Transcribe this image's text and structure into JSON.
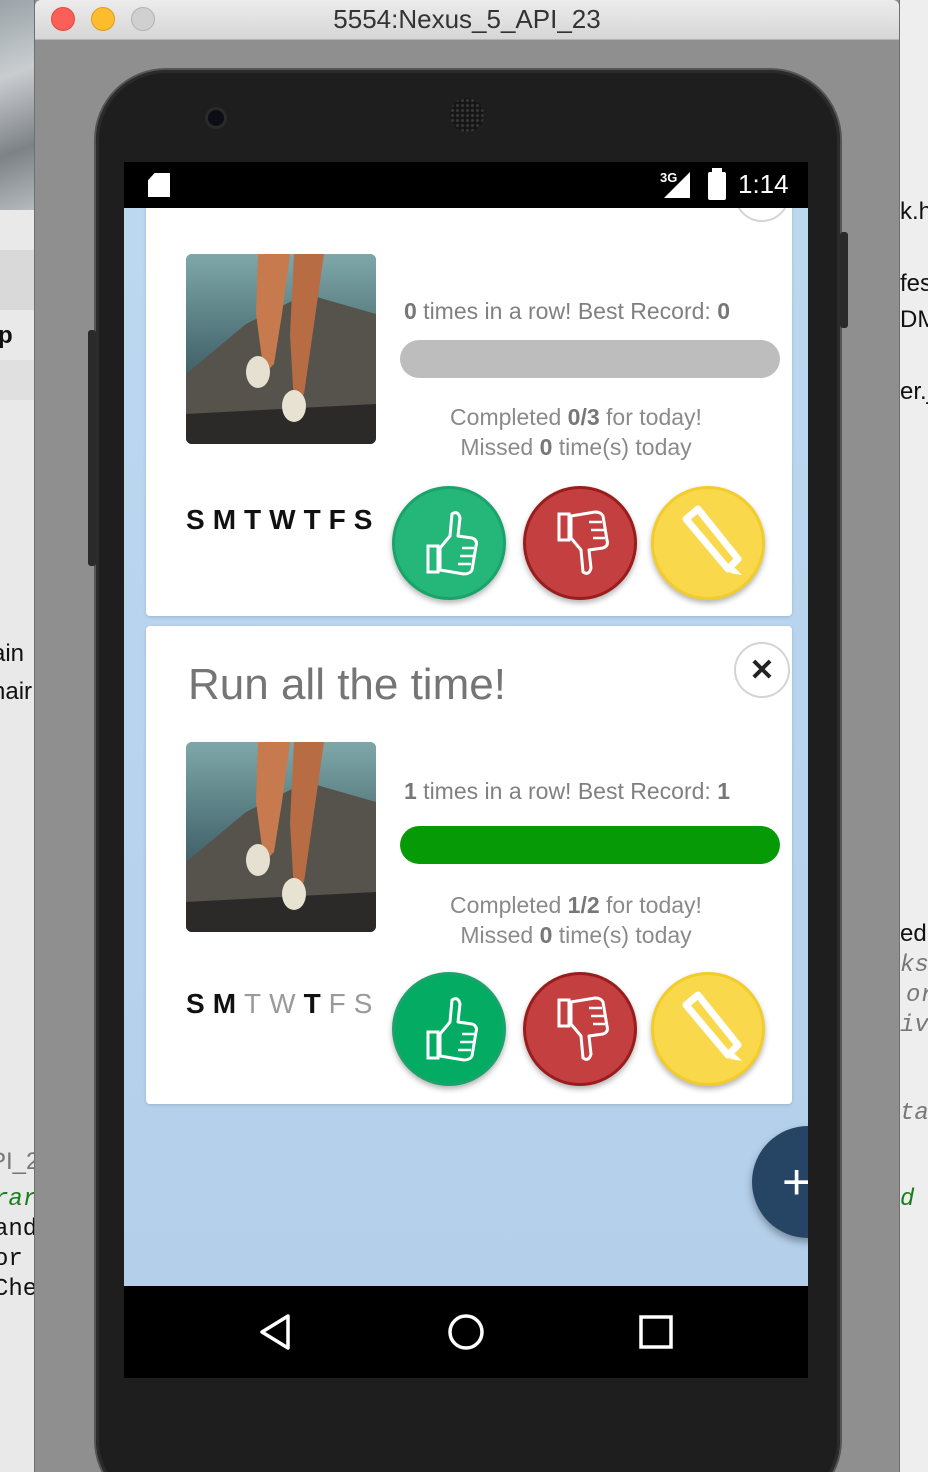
{
  "window": {
    "title": "5554:Nexus_5_API_23"
  },
  "background_text": {
    "left": [
      "p",
      "ain",
      "nair",
      "PI_2",
      "rar",
      "and",
      "or v",
      "Che"
    ],
    "right": [
      "k.ht",
      "fes",
      "DM",
      "er.j",
      "ed",
      "ks",
      "or",
      "ivi",
      "ta",
      "d"
    ]
  },
  "statusbar": {
    "network": "3G",
    "time": "1:14"
  },
  "cards": [
    {
      "title": "",
      "streak_prefix": "0",
      "streak_mid": " times in a row! Best Record: ",
      "best": "0",
      "progress": 0,
      "completed_label": "Completed ",
      "completed": "0/3",
      "completed_suffix": " for today!",
      "missed_label": "Missed ",
      "missed": "0",
      "missed_suffix": " time(s) today",
      "days": [
        {
          "letter": "S",
          "done": true
        },
        {
          "letter": "M",
          "done": true
        },
        {
          "letter": "T",
          "done": true
        },
        {
          "letter": "W",
          "done": true
        },
        {
          "letter": "T",
          "done": true
        },
        {
          "letter": "F",
          "done": true
        },
        {
          "letter": "S",
          "done": true
        }
      ]
    },
    {
      "title": "Run all the time!",
      "streak_prefix": "1",
      "streak_mid": " times in a row! Best Record: ",
      "best": "1",
      "progress": 1.0,
      "completed_label": "Completed ",
      "completed": "1/2",
      "completed_suffix": " for today!",
      "missed_label": "Missed ",
      "missed": "0",
      "missed_suffix": " time(s) today",
      "days": [
        {
          "letter": "S",
          "done": true
        },
        {
          "letter": "M",
          "done": true
        },
        {
          "letter": "T",
          "done": false
        },
        {
          "letter": "W",
          "done": false
        },
        {
          "letter": "T",
          "done": true
        },
        {
          "letter": "F",
          "done": false
        },
        {
          "letter": "S",
          "done": false
        }
      ]
    }
  ],
  "close_label": "✕",
  "fab_label": "+",
  "colors": {
    "success": "#069a06",
    "thumbs_up": "#25b77a",
    "thumbs_down": "#c43f3f",
    "edit": "#f9d84b",
    "fab": "#264565",
    "app_bg": "#bcd8f1"
  },
  "icons": [
    "thumbs-up-icon",
    "thumbs-down-icon",
    "pencil-icon",
    "back-icon",
    "home-icon",
    "recents-icon",
    "close-icon",
    "plus-icon",
    "sd-card-icon",
    "signal-icon",
    "battery-icon"
  ]
}
